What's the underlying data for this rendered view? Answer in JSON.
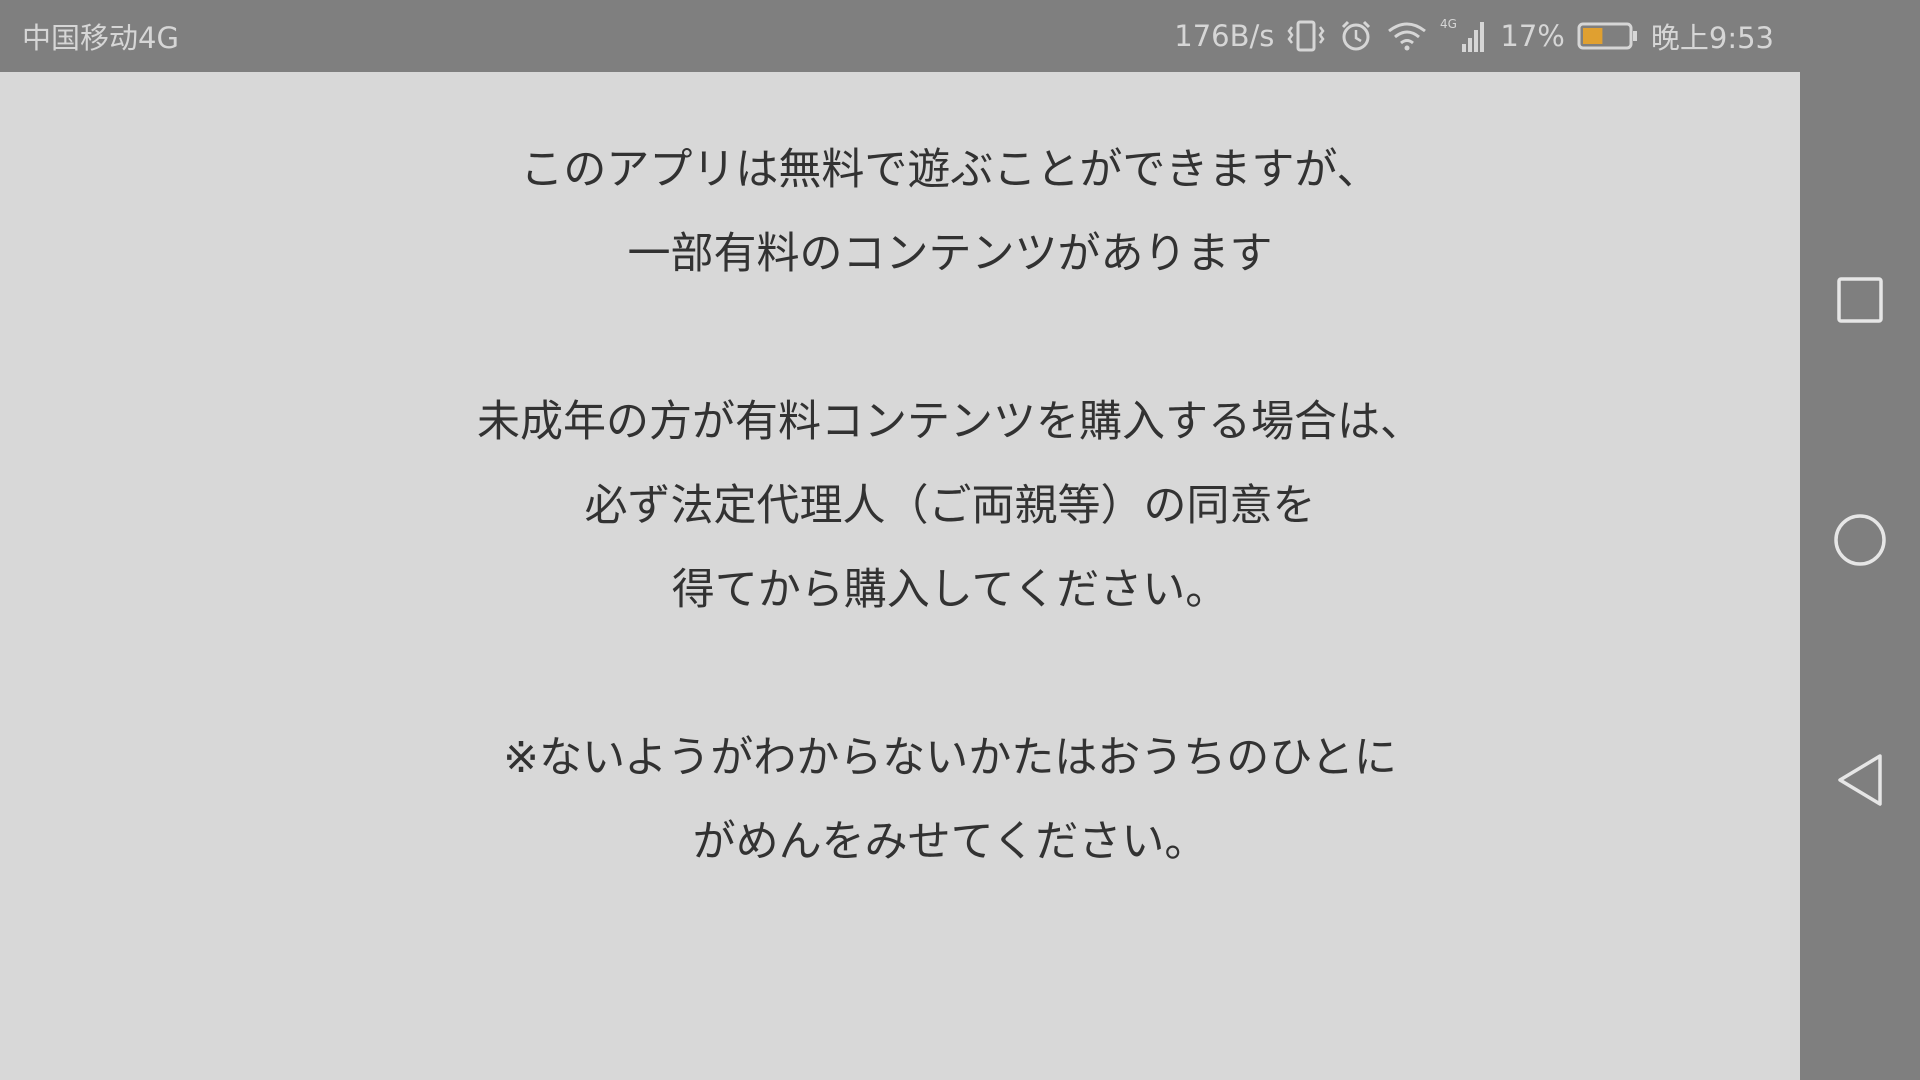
{
  "status_bar": {
    "carrier": "中国移动4G",
    "net_speed": "176B/s",
    "network_type": "4G",
    "battery_percent": "17%",
    "battery_level": 0.17,
    "time": "晚上9:53",
    "icons": [
      "vibrate-icon",
      "alarm-icon",
      "wifi-icon",
      "cellular-signal-icon",
      "battery-icon"
    ],
    "colors": {
      "text": "#d6d6d6",
      "battery_fill": "#e0a030"
    }
  },
  "message": {
    "line1": "このアプリは無料で遊ぶことができますが、",
    "line2": "一部有料のコンテンツがあります",
    "line3": "未成年の方が有料コンテンツを購入する場合は、",
    "line4": "必ず法定代理人（ご両親等）の同意を",
    "line5": "得てから購入してください。",
    "line6": "※ないようがわからないかたはおうちのひとに",
    "line7": "がめんをみせてください。"
  },
  "nav_bar": {
    "buttons": [
      "recent-apps-button",
      "home-button",
      "back-button"
    ]
  },
  "colors": {
    "background": "#d8d8d8",
    "text": "#323232",
    "chrome": "#7f7f7f"
  }
}
